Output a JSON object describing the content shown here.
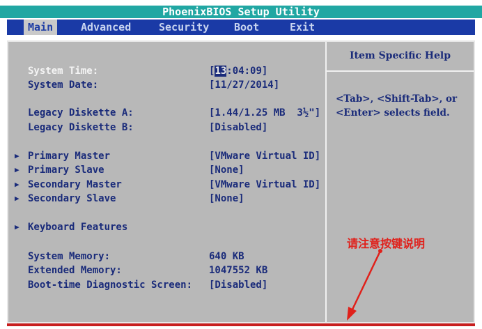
{
  "title": "PhoenixBIOS Setup Utility",
  "menu": [
    "Main",
    "Advanced",
    "Security",
    "Boot",
    "Exit"
  ],
  "help": {
    "title": "Item Specific Help",
    "text": "<Tab>, <Shift-Tab>, or <Enter> selects field."
  },
  "system_time": {
    "label": "System Time:",
    "open": "[",
    "hour": "13",
    "rest": ":04:09]"
  },
  "rows": [
    {
      "label": "System Date:",
      "value": "[11/27/2014]"
    },
    {
      "label": "Legacy Diskette A:",
      "value": "[1.44/1.25 MB  3½\"]"
    },
    {
      "label": "Legacy Diskette B:",
      "value": "[Disabled]"
    },
    {
      "label": "Primary Master",
      "value": "[VMware Virtual ID]"
    },
    {
      "label": "Primary Slave",
      "value": "[None]"
    },
    {
      "label": "Secondary Master",
      "value": "[VMware Virtual ID]"
    },
    {
      "label": "Secondary Slave",
      "value": "[None]"
    },
    {
      "label": "Keyboard Features",
      "value": ""
    },
    {
      "label": "System Memory:",
      "value": "640 KB"
    },
    {
      "label": "Extended Memory:",
      "value": "1047552 KB"
    },
    {
      "label": "Boot-time Diagnostic Screen:",
      "value": "[Disabled]"
    }
  ],
  "annotation": "请注意按键说明",
  "colors": {
    "title_bar": "#21a7a3",
    "menu_bar": "#1a3aa6",
    "panel": "#b8b8b8",
    "text": "#1a2b7a",
    "annotation": "#e0201a"
  }
}
